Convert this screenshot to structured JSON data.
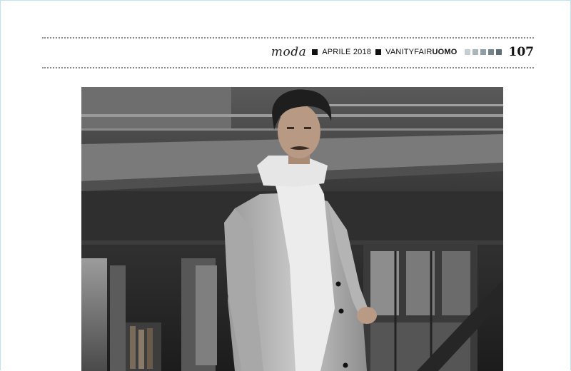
{
  "header": {
    "section": "moda",
    "issue": "APRILE 2018",
    "magazine_prefix": "VANITYFAIR",
    "magazine_suffix": "UOMO",
    "page_number": "107"
  },
  "colors": {
    "frame_border": "#bfe3f2",
    "rule": "#8a8a8a",
    "bar_colors": [
      "#c5ced3",
      "#aab6bc",
      "#8f9da4",
      "#75858d",
      "#5d6e76"
    ]
  },
  "photo": {
    "description": "black-and-white fashion photograph"
  }
}
